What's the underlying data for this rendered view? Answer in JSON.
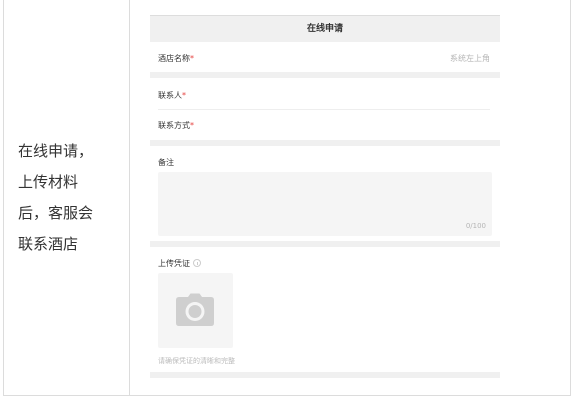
{
  "left_column": {
    "lines": [
      "在线申请，",
      "上传材料",
      "后，客服会",
      "联系酒店"
    ]
  },
  "form": {
    "title": "在线申请",
    "hotel_name": {
      "label": "酒店名称",
      "required_mark": "*",
      "hint": "系统左上角"
    },
    "contact_person": {
      "label": "联系人",
      "required_mark": "*"
    },
    "contact_method": {
      "label": "联系方式",
      "required_mark": "*"
    },
    "remarks": {
      "label": "备注",
      "counter": "0/100"
    },
    "upload": {
      "label": "上传凭证",
      "hint": "请确保凭证的清晰和完整",
      "icon": "camera-icon"
    }
  }
}
